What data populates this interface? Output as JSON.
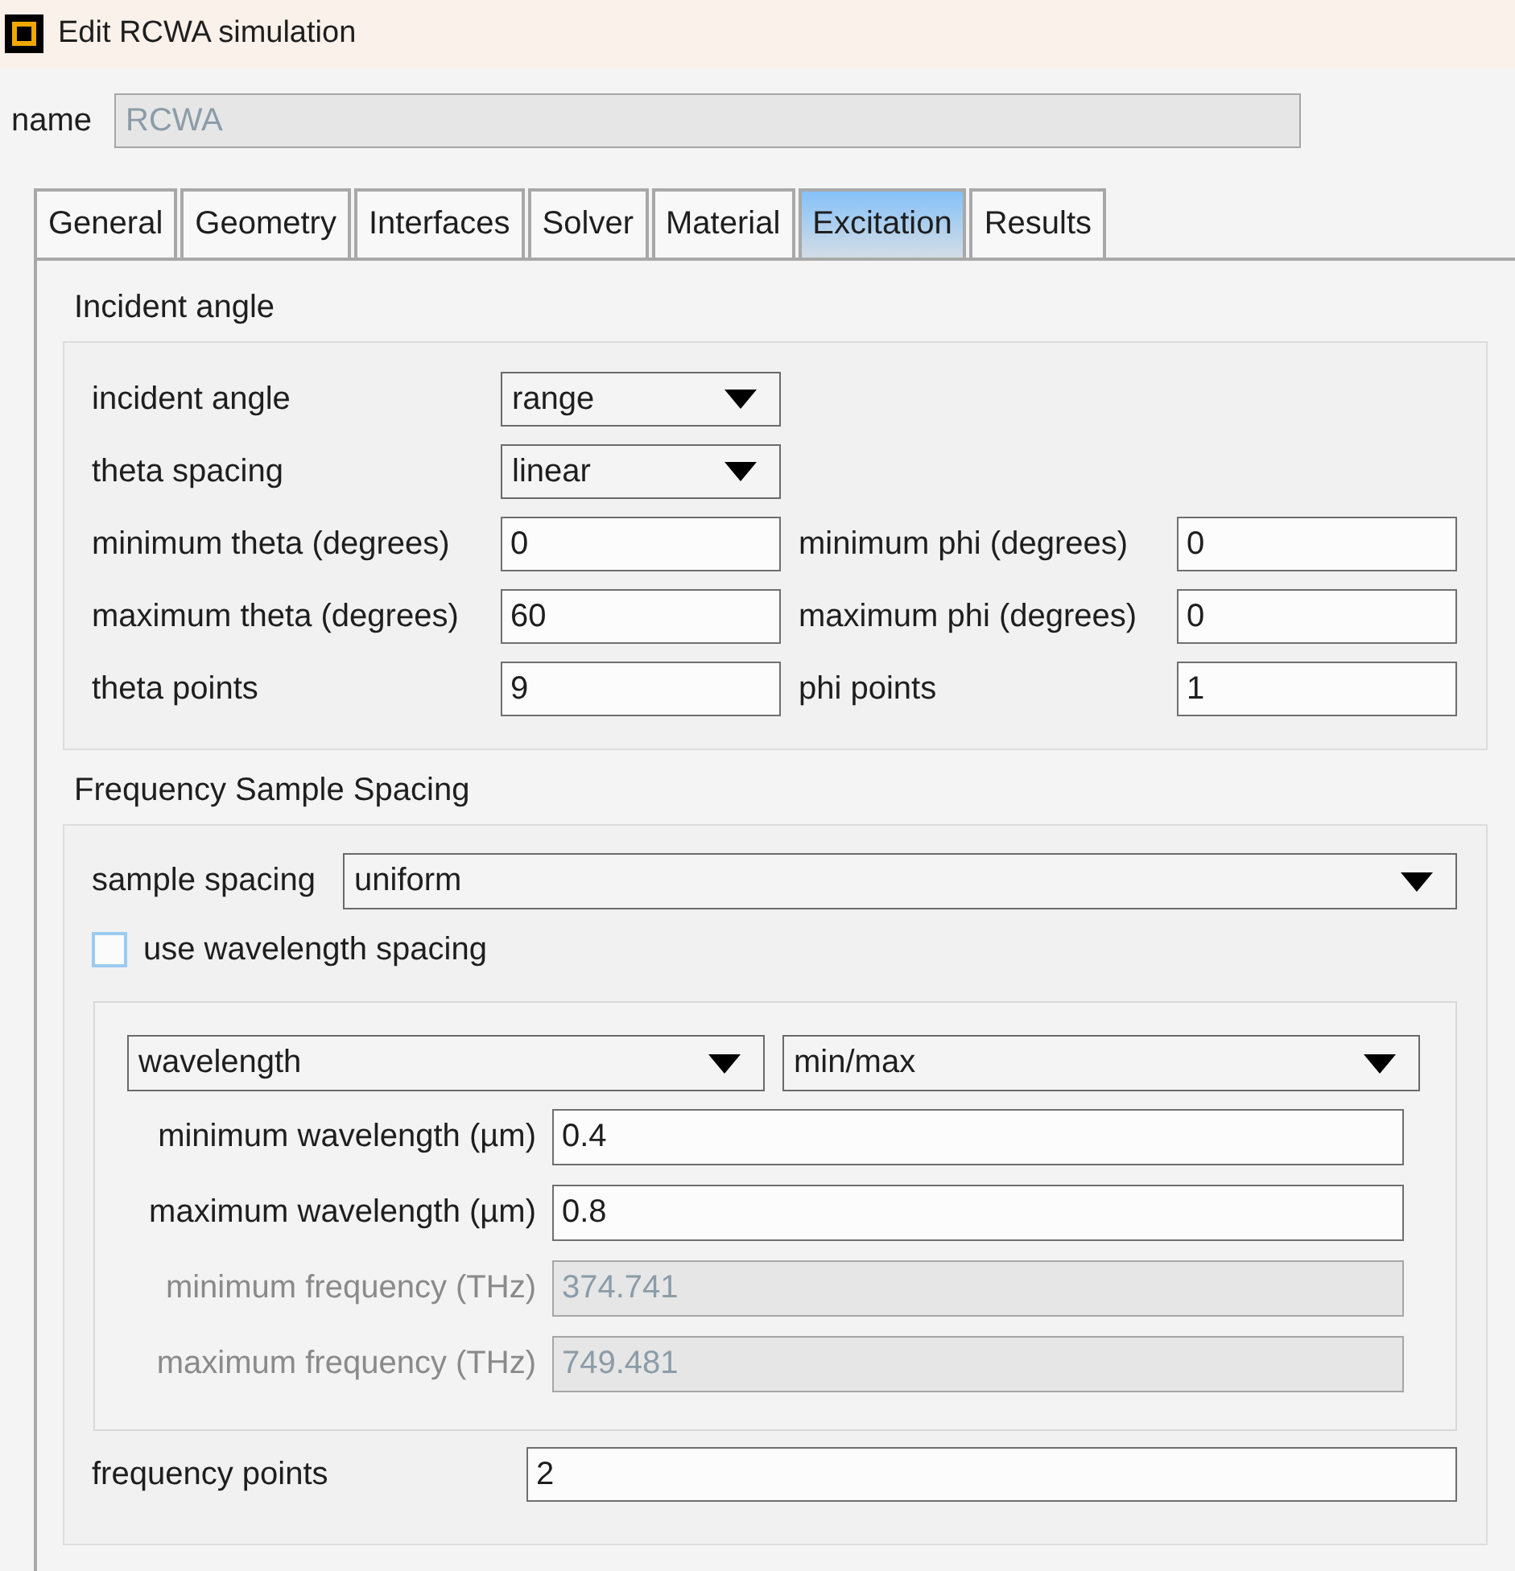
{
  "window": {
    "title": "Edit RCWA simulation"
  },
  "name_field": {
    "label": "name",
    "value": "RCWA",
    "disabled": true
  },
  "tabs": [
    {
      "label": "General",
      "selected": false
    },
    {
      "label": "Geometry",
      "selected": false
    },
    {
      "label": "Interfaces",
      "selected": false
    },
    {
      "label": "Solver",
      "selected": false
    },
    {
      "label": "Material",
      "selected": false
    },
    {
      "label": "Excitation",
      "selected": true
    },
    {
      "label": "Results",
      "selected": false
    }
  ],
  "incident_angle": {
    "title": "Incident angle",
    "rows": [
      {
        "fields": [
          {
            "kind": "dropdown",
            "label": "incident angle",
            "value": "range"
          }
        ]
      },
      {
        "fields": [
          {
            "kind": "dropdown",
            "label": "theta spacing",
            "value": "linear"
          }
        ]
      },
      {
        "fields": [
          {
            "kind": "input",
            "label": "minimum theta (degrees)",
            "value": "0"
          },
          {
            "kind": "input",
            "label": "minimum phi (degrees)",
            "value": "0"
          }
        ]
      },
      {
        "fields": [
          {
            "kind": "input",
            "label": "maximum theta (degrees)",
            "value": "60"
          },
          {
            "kind": "input",
            "label": "maximum phi (degrees)",
            "value": "0"
          }
        ]
      },
      {
        "fields": [
          {
            "kind": "input",
            "label": "theta points",
            "value": "9"
          },
          {
            "kind": "input",
            "label": "phi points",
            "value": "1"
          }
        ]
      }
    ]
  },
  "frequency_sample_spacing": {
    "title": "Frequency Sample Spacing",
    "sample_spacing": {
      "label": "sample spacing",
      "value": "uniform"
    },
    "use_wavelength_spacing": {
      "label": "use wavelength spacing",
      "checked": false
    },
    "range": {
      "selectors": [
        {
          "value": "wavelength"
        },
        {
          "value": "min/max"
        }
      ],
      "fields": [
        {
          "label": "minimum wavelength (µm)",
          "value": "0.4",
          "disabled": false
        },
        {
          "label": "maximum wavelength (µm)",
          "value": "0.8",
          "disabled": false
        },
        {
          "label": "minimum frequency (THz)",
          "value": "374.741",
          "disabled": true
        },
        {
          "label": "maximum frequency (THz)",
          "value": "749.481",
          "disabled": true
        }
      ]
    },
    "frequency_points": {
      "label": "frequency points",
      "value": "2"
    }
  }
}
